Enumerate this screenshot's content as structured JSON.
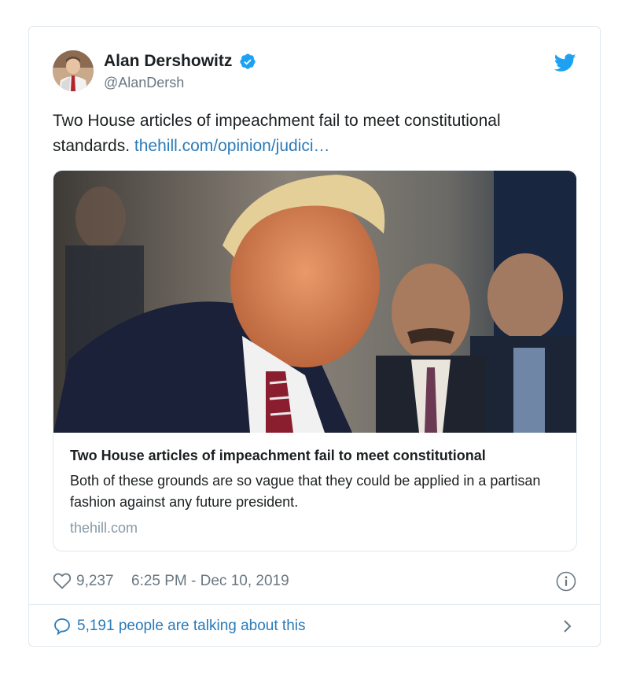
{
  "author": {
    "display_name": "Alan Dershowitz",
    "handle": "@AlanDersh",
    "verified": true,
    "avatar_icon": "avatar-photo"
  },
  "tweet": {
    "text": "Two House articles of impeachment fail to meet constitutional standards.",
    "link_text": "thehill.com/opinion/judici…"
  },
  "card": {
    "image_description": "photo",
    "title": "Two House articles of impeachment fail to meet constitutional",
    "description": "Both of these grounds are so vague that they could be applied in a partisan fashion against any future president.",
    "domain": "thehill.com"
  },
  "meta": {
    "likes": "9,237",
    "timestamp": "6:25 PM - Dec 10, 2019"
  },
  "footer": {
    "talking_label": "5,191 people are talking about this"
  },
  "colors": {
    "link": "#2b7bb9",
    "verified": "#1da1f2",
    "muted": "#697882",
    "border": "#e1e8ed"
  },
  "icons": [
    "verified-badge-icon",
    "twitter-bird-icon",
    "heart-icon",
    "info-icon",
    "speech-bubble-icon",
    "chevron-right-icon"
  ]
}
